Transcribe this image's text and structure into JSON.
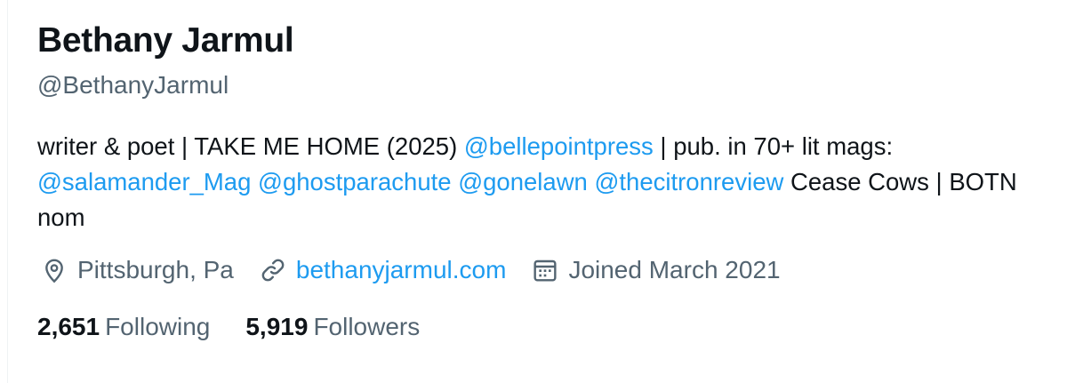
{
  "profile": {
    "display_name": "Bethany Jarmul",
    "handle": "@BethanyJarmul",
    "bio": {
      "t1": "writer & poet | TAKE ME HOME (2025) ",
      "m1": "@bellepointpress",
      "t2": " | pub. in 70+ lit mags: ",
      "m2": "@salamander_Mag",
      "m3": "@ghostparachute",
      "m4": "@gonelawn",
      "m5": "@thecitronreview",
      "t3": " Cease Cows | BOTN nom"
    },
    "location": "Pittsburgh, Pa",
    "website": "bethanyjarmul.com",
    "joined": "Joined March 2021",
    "following_count": "2,651",
    "following_label": "Following",
    "followers_count": "5,919",
    "followers_label": "Followers"
  },
  "icons": {
    "location": "location-pin-icon",
    "website": "link-icon",
    "joined": "calendar-icon"
  },
  "colors": {
    "text": "#0f1419",
    "secondary": "#536471",
    "accent": "#1d9bf0"
  }
}
